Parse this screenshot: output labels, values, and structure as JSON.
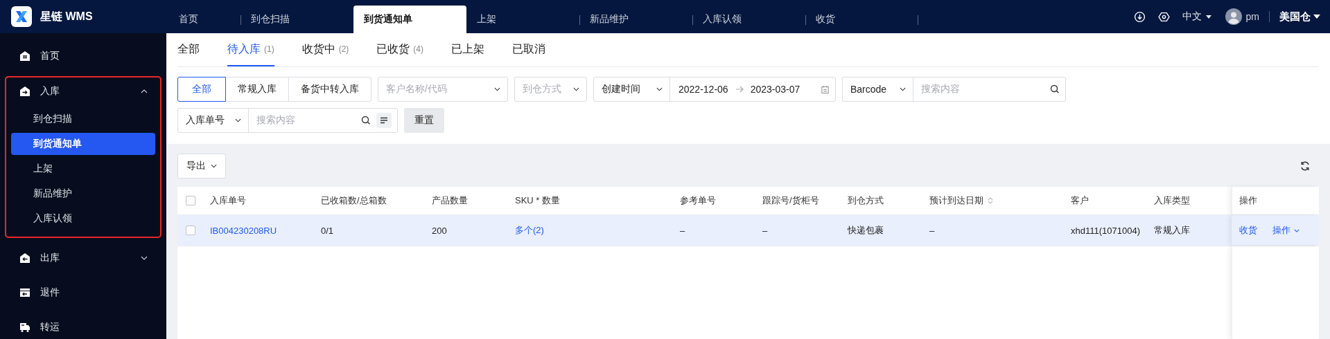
{
  "app": {
    "name": "星链 WMS"
  },
  "top_tabs": [
    {
      "label": "首页",
      "selected": false
    },
    {
      "label": "到仓扫描",
      "selected": false
    },
    {
      "label": "到货通知单",
      "selected": true
    },
    {
      "label": "上架",
      "selected": false
    },
    {
      "label": "新品维护",
      "selected": false
    },
    {
      "label": "入库认领",
      "selected": false
    },
    {
      "label": "收货",
      "selected": false
    }
  ],
  "header": {
    "language": "中文",
    "user": "pm",
    "warehouse": "美国仓"
  },
  "sidebar": {
    "items": [
      {
        "kind": "home",
        "label": "首页"
      },
      {
        "kind": "inbound",
        "label": "入库",
        "expanded": true,
        "highlighted": true,
        "children": [
          {
            "label": "到仓扫描",
            "selected": false
          },
          {
            "label": "到货通知单",
            "selected": true
          },
          {
            "label": "上架",
            "selected": false
          },
          {
            "label": "新品维护",
            "selected": false
          },
          {
            "label": "入库认领",
            "selected": false
          }
        ]
      },
      {
        "kind": "outbound",
        "label": "出库",
        "expanded": false
      },
      {
        "kind": "returns",
        "label": "退件"
      },
      {
        "kind": "transfer",
        "label": "转运"
      }
    ]
  },
  "status_tabs": [
    {
      "label": "全部",
      "selected": false
    },
    {
      "label": "待入库",
      "count": "(1)",
      "selected": true
    },
    {
      "label": "收货中",
      "count": "(2)",
      "selected": false
    },
    {
      "label": "已收货",
      "count": "(4)",
      "selected": false
    },
    {
      "label": "已上架",
      "selected": false
    },
    {
      "label": "已取消",
      "selected": false
    }
  ],
  "filters": {
    "type_buttons": [
      {
        "label": "全部",
        "selected": true
      },
      {
        "label": "常规入库",
        "selected": false
      },
      {
        "label": "备货中转入库",
        "selected": false
      }
    ],
    "customer": {
      "placeholder": "客户名称/代码"
    },
    "arrival_method": {
      "placeholder": "到仓方式"
    },
    "date": {
      "field": "创建时间",
      "start": "2022-12-06",
      "end": "2023-03-07"
    },
    "barcode": {
      "field": "Barcode",
      "placeholder": "搜索内容"
    },
    "order": {
      "field": "入库单号",
      "placeholder": "搜索内容"
    },
    "reset": "重置"
  },
  "toolbar": {
    "export": "导出"
  },
  "table": {
    "all_checked": false,
    "columns": [
      {
        "label": "入库单号"
      },
      {
        "label": "已收箱数/总箱数"
      },
      {
        "label": "产品数量"
      },
      {
        "label": "SKU * 数量"
      },
      {
        "label": "参考单号"
      },
      {
        "label": "跟踪号/货柜号"
      },
      {
        "label": "到仓方式"
      },
      {
        "label": "预计到达日期",
        "sortable": true
      },
      {
        "label": "客户"
      },
      {
        "label": "入库类型"
      },
      {
        "label": "操作"
      }
    ],
    "rows": [
      {
        "checked": false,
        "highlighted": true,
        "order_no": "IB004230208RU",
        "boxes": "0/1",
        "quantity": "200",
        "sku": "多个(2)",
        "reference": "–",
        "tracking": "–",
        "arrival_method": "快递包裹",
        "eta": "–",
        "customer": "xhd111(1071004)",
        "type": "常规入库",
        "actions": [
          "收货",
          "操作"
        ]
      }
    ]
  }
}
